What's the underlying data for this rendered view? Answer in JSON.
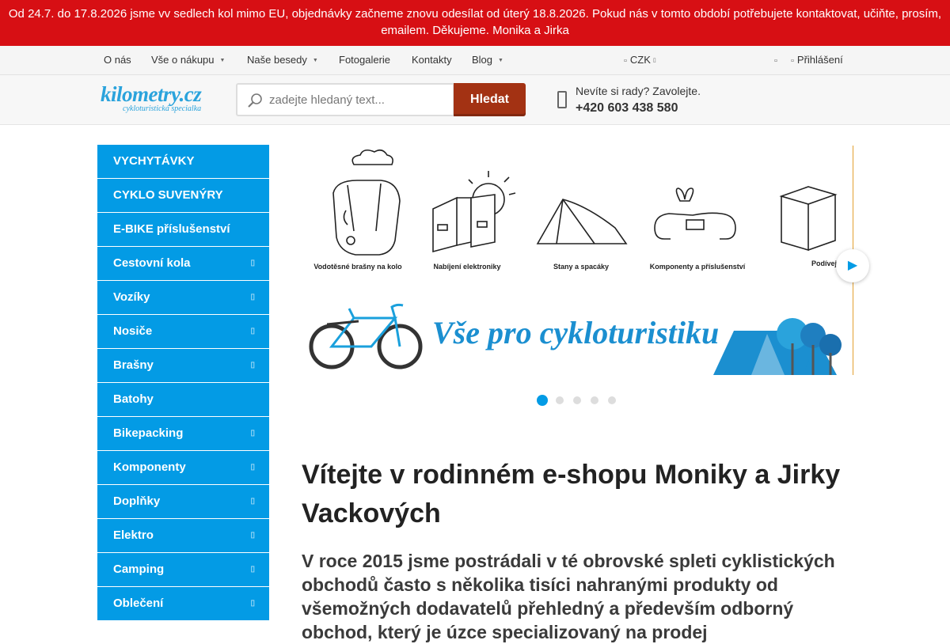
{
  "notice": {
    "line1": "Od 24.7. do 17.8.2026 jsme vv sedlech kol mimo EU, objednávky začneme znovu odesílat od úterý 18.8.2026. Pokud nás v tomto období potřebujete kontaktovat, učiňte, prosím,",
    "line2": "emailem. Děkujeme. Monika a Jirka"
  },
  "topnav": {
    "items": [
      "O nás",
      "Vše o nákupu",
      "Naše besedy",
      "Fotogalerie",
      "Kontakty",
      "Blog"
    ],
    "currency": "CZK",
    "login": "Přihlášení"
  },
  "header": {
    "logo_main": "kilometry.cz",
    "logo_sub": "cykloturistická specialka",
    "search_placeholder": "zadejte hledaný text...",
    "search_button": "Hledat",
    "phone_prompt": "Nevíte si rady? Zavolejte.",
    "phone_number": "+420 603 438 580"
  },
  "sidebar": {
    "categories": [
      {
        "label": "VYCHYTÁVKY",
        "sub": false
      },
      {
        "label": "CYKLO SUVENÝRY",
        "sub": false
      },
      {
        "label": "E-BIKE příslušenství",
        "sub": false
      },
      {
        "label": "Cestovní kola",
        "sub": true
      },
      {
        "label": "Vozíky",
        "sub": true
      },
      {
        "label": "Nosiče",
        "sub": true
      },
      {
        "label": "Brašny",
        "sub": true
      },
      {
        "label": "Batohy",
        "sub": false
      },
      {
        "label": "Bikepacking",
        "sub": true
      },
      {
        "label": "Komponenty",
        "sub": true
      },
      {
        "label": "Doplňky",
        "sub": true
      },
      {
        "label": "Elektro",
        "sub": true
      },
      {
        "label": "Camping",
        "sub": true
      },
      {
        "label": "Oblečení",
        "sub": true
      }
    ]
  },
  "banner": {
    "tiles": [
      "Vodotěsné brašny na kolo",
      "Nabíjení elektroniky",
      "Stany a spacáky",
      "Komponenty a příslušenství",
      "Podívej se na další vychytávky"
    ],
    "slogan": "Vše pro cykloturistiku",
    "slides": 5,
    "active_slide": 1
  },
  "main": {
    "welcome": "Vítejte v rodinném e-shopu Moniky a Jirky Vackových",
    "lead": "V roce 2015 jsme postrádali v té obrovské spleti cyklistických obchodů často s několika tisíci nahranými produkty od všemožných dodavatelů přehledný a především odborný obchod, který je úzce specializovaný na prodej"
  },
  "colors": {
    "notice_bg": "#d70f14",
    "accent_blue": "#039be5",
    "search_button": "#a33213"
  }
}
